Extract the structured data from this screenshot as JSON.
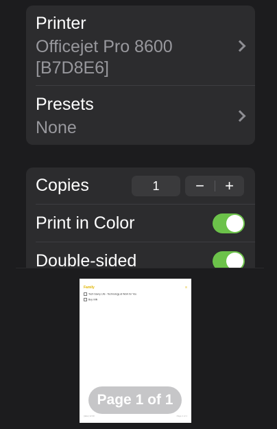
{
  "printer": {
    "label": "Printer",
    "value_line1": "Officejet Pro 8600",
    "value_line2": "[B7D8E6]"
  },
  "presets": {
    "label": "Presets",
    "value": "None"
  },
  "copies": {
    "label": "Copies",
    "count": "1",
    "minus": "−",
    "plus": "+"
  },
  "print_in_color": {
    "label": "Print in Color",
    "on": true
  },
  "double_sided": {
    "label": "Double-sided",
    "on": true
  },
  "preview": {
    "doc_title": "Family",
    "doc_marker": "≡",
    "doc_items": [
      "Tech Savvy Life - Technology at Work for You",
      "Buy milk"
    ],
    "footer_left": "[date] 12:30",
    "footer_right": "Page 1 of 1",
    "page_indicator": "Page 1 of 1"
  },
  "colors": {
    "background": "#1c1c1e",
    "group": "#2c2c2e",
    "toggle_on": "#6cc24a",
    "secondary_text": "#98989d"
  }
}
